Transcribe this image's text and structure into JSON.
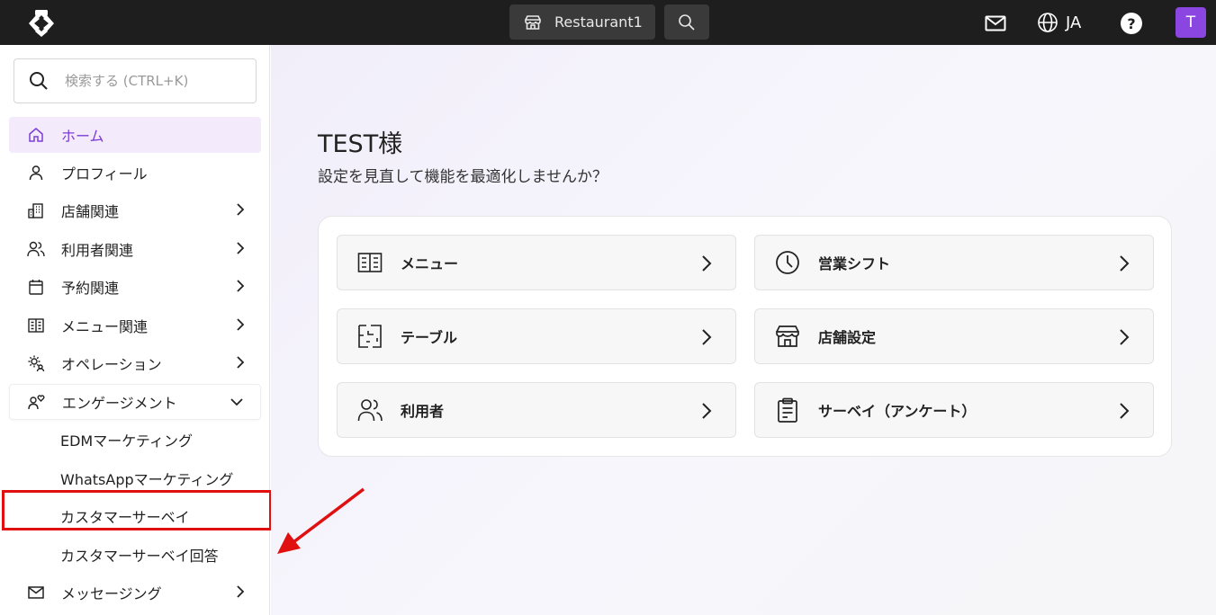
{
  "topbar": {
    "store_label": "Restaurant1",
    "language": "JA",
    "help_label": "?",
    "avatar_initial": "T"
  },
  "sidebar": {
    "search_placeholder": "検索する (CTRL+K)",
    "items": [
      {
        "label": "ホーム",
        "icon": "home-icon",
        "active": true
      },
      {
        "label": "プロフィール",
        "icon": "person-icon"
      },
      {
        "label": "店舗関連",
        "icon": "building-icon",
        "chevron": "right"
      },
      {
        "label": "利用者関連",
        "icon": "users-icon",
        "chevron": "right"
      },
      {
        "label": "予約関連",
        "icon": "calendar-icon",
        "chevron": "right"
      },
      {
        "label": "メニュー関連",
        "icon": "menu-book-icon",
        "chevron": "right"
      },
      {
        "label": "オペレーション",
        "icon": "gear-users-icon",
        "chevron": "right"
      },
      {
        "label": "エンゲージメント",
        "icon": "engagement-icon",
        "chevron": "down"
      },
      {
        "label": "メッセージング",
        "icon": "mail-icon",
        "chevron": "right"
      }
    ],
    "engagement_sub_items": [
      "EDMマーケティング",
      "WhatsAppマーケティング",
      "カスタマーサーベイ",
      "カスタマーサーベイ回答"
    ]
  },
  "main": {
    "greeting": "TEST様",
    "sub_greeting": "設定を見直して機能を最適化しませんか？",
    "tiles": [
      {
        "label": "メニュー",
        "icon": "menu-book-icon"
      },
      {
        "label": "営業シフト",
        "icon": "clock-icon"
      },
      {
        "label": "テーブル",
        "icon": "floor-plan-icon"
      },
      {
        "label": "店舗設定",
        "icon": "storefront-icon"
      },
      {
        "label": "利用者",
        "icon": "users-icon"
      },
      {
        "label": "サーベイ（アンケート）",
        "icon": "clipboard-icon"
      }
    ]
  },
  "colors": {
    "topbar_bg": "#1e1e1e",
    "accent": "#8b45e0",
    "active_text": "#7d3cd6",
    "active_bg": "#f3ebfc",
    "annotation_red": "#e01010"
  }
}
